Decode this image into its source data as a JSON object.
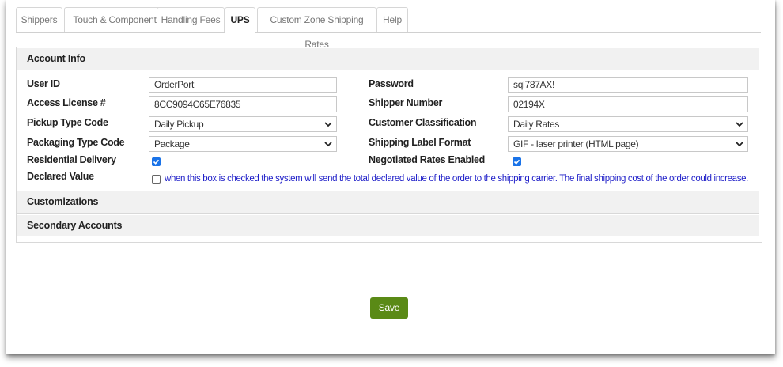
{
  "tabs": [
    {
      "label": "Shippers"
    },
    {
      "label": "Touch & Components"
    },
    {
      "label": "Handling Fees"
    },
    {
      "label": "UPS"
    },
    {
      "label": "Custom Zone Shipping Rates"
    },
    {
      "label": "Help"
    }
  ],
  "active_tab": "UPS",
  "sections": {
    "account_info": "Account Info",
    "customizations": "Customizations",
    "secondary_accounts": "Secondary Accounts"
  },
  "form": {
    "user_id": {
      "label": "User ID",
      "value": "OrderPort"
    },
    "password": {
      "label": "Password",
      "value": "sql787AX!"
    },
    "access_license": {
      "label": "Access License #",
      "value": "8CC9094C65E76835"
    },
    "shipper_number": {
      "label": "Shipper Number",
      "value": "02194X"
    },
    "pickup_type": {
      "label": "Pickup Type Code",
      "value": "Daily Pickup"
    },
    "customer_classification": {
      "label": "Customer Classification",
      "value": "Daily Rates"
    },
    "packaging_type": {
      "label": "Packaging Type Code",
      "value": "Package"
    },
    "label_format": {
      "label": "Shipping Label Format",
      "value": "GIF - laser printer (HTML page)"
    },
    "residential_delivery": {
      "label": "Residential Delivery",
      "checked": true
    },
    "negotiated_rates": {
      "label": "Negotiated Rates Enabled",
      "checked": true
    },
    "declared_value": {
      "label": "Declared Value",
      "checked": false,
      "note": "when this box is checked the system will send the total declared value of the order to the shipping carrier. The final shipping cost of the order could increase."
    }
  },
  "save_label": "Save",
  "colors": {
    "checkbox_blue": "#1a73e8",
    "save_green": "#5a8a16",
    "note_blue": "#1e1ec8"
  }
}
